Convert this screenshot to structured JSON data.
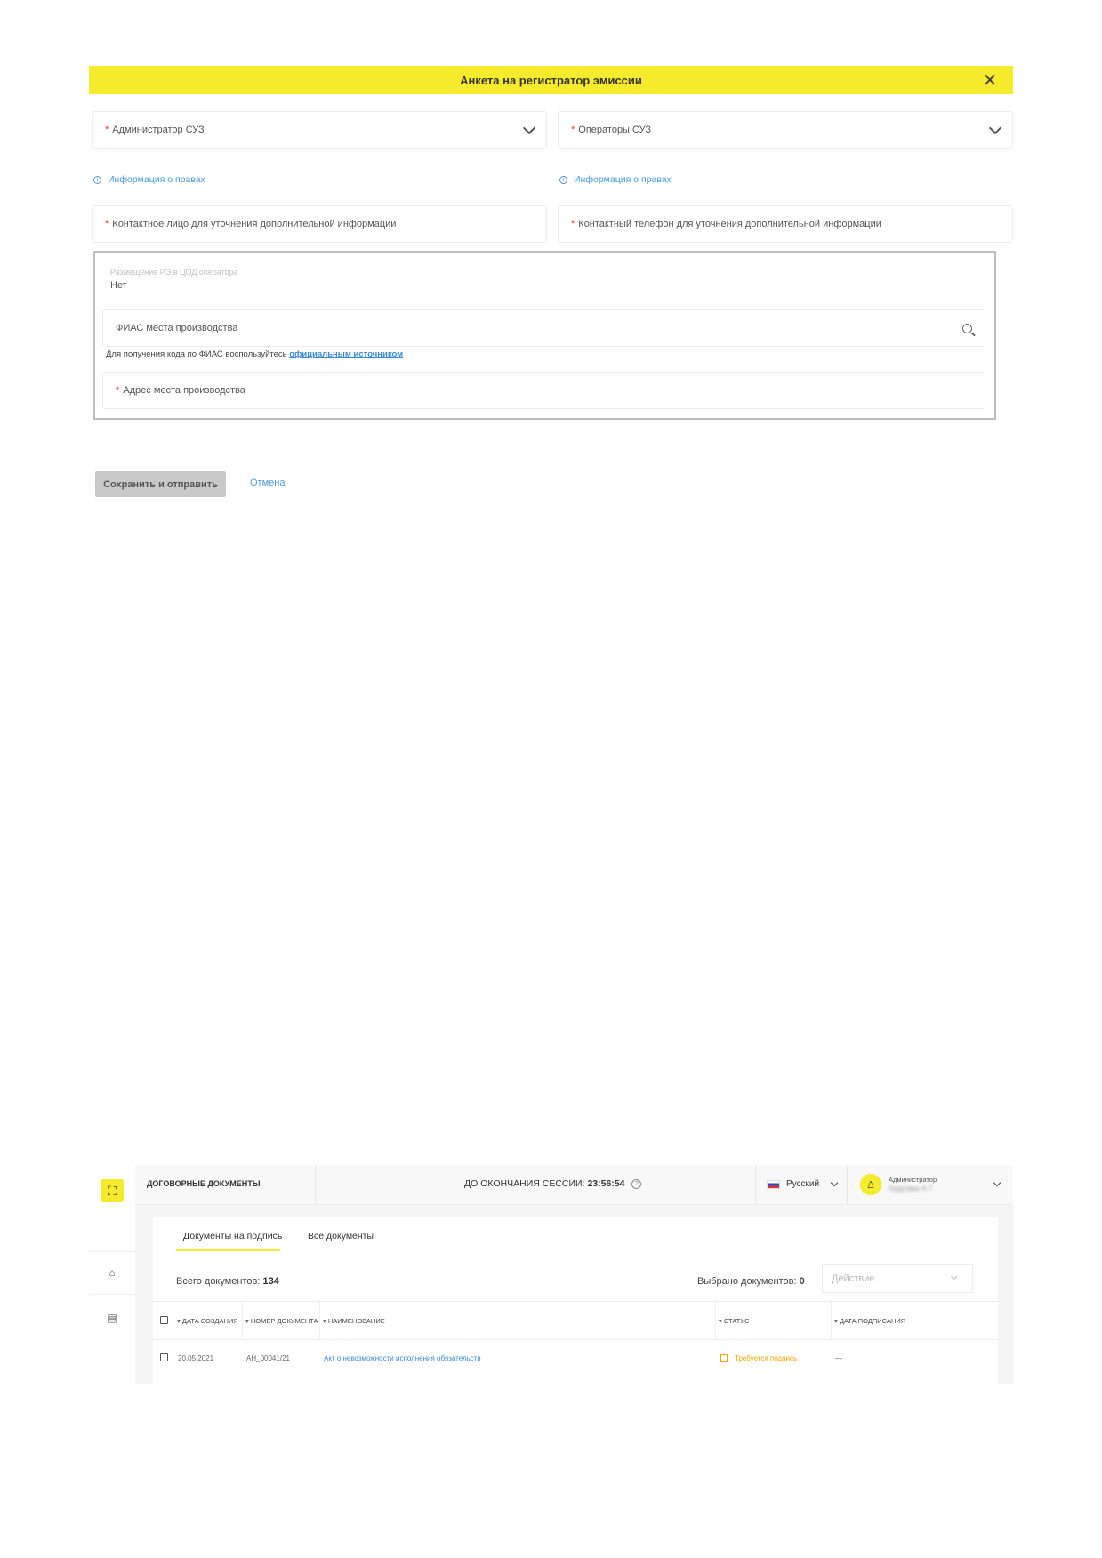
{
  "modal": {
    "title": "Анкета на регистратор эмиссии",
    "close_symbol": "✕",
    "admin_field": {
      "required": "*",
      "label": "Администратор СУЗ"
    },
    "operators_field": {
      "required": "*",
      "label": "Операторы СУЗ"
    },
    "info_link_left": "Информация о правах",
    "info_link_right": "Информация о правах",
    "contact_person": {
      "required": "*",
      "label": "Контактное лицо для уточнения дополнительной информации"
    },
    "contact_phone": {
      "required": "*",
      "label": "Контактный телефон для уточнения дополнительной информации"
    },
    "placement": {
      "label": "Размещение РЭ в ЦОД оператора",
      "value": "Нет"
    },
    "fias_field": {
      "placeholder": "ФИАС места производства"
    },
    "hint_text": "Для получения кода по ФИАС воспользуйтесь ",
    "hint_link": "официальным источником",
    "address_field": {
      "required": "*",
      "label": "Адрес места производства"
    },
    "save_label": "Сохранить и отправить",
    "cancel_label": "Отмена"
  },
  "app": {
    "section_title": "ДОГОВОРНЫЕ ДОКУМЕНТЫ",
    "session_label": "ДО ОКОНЧАНИЯ СЕССИИ:",
    "session_time": "23:56:54",
    "help_symbol": "?",
    "language": "Русский",
    "user_role": "Администратор",
    "user_name": "Кадровик А.Т.",
    "tabs": [
      {
        "label": "Документы на подпись",
        "active": true
      },
      {
        "label": "Все документы",
        "active": false
      }
    ],
    "total_label": "Всего документов:",
    "total_count": "134",
    "selected_label": "Выбрано документов:",
    "selected_count": "0",
    "action_placeholder": "Действие",
    "columns": [
      "ДАТА СОЗДАНИЯ",
      "НОМЕР ДОКУМЕНТА",
      "НАИМЕНОВАНИЕ",
      "СТАТУС",
      "ДАТА ПОДПИСАНИЯ"
    ],
    "rows": [
      {
        "date": "20.05.2021",
        "number": "АН_00041/21",
        "name": "Акт о невозможности исполнения обязательств",
        "status": "Требуется подпись",
        "signed_date": "—"
      }
    ]
  },
  "colors": {
    "accent": "#f6ea2c",
    "link": "#4a9ad8",
    "status_pending": "#f0a800",
    "required": "#e23b3b"
  }
}
